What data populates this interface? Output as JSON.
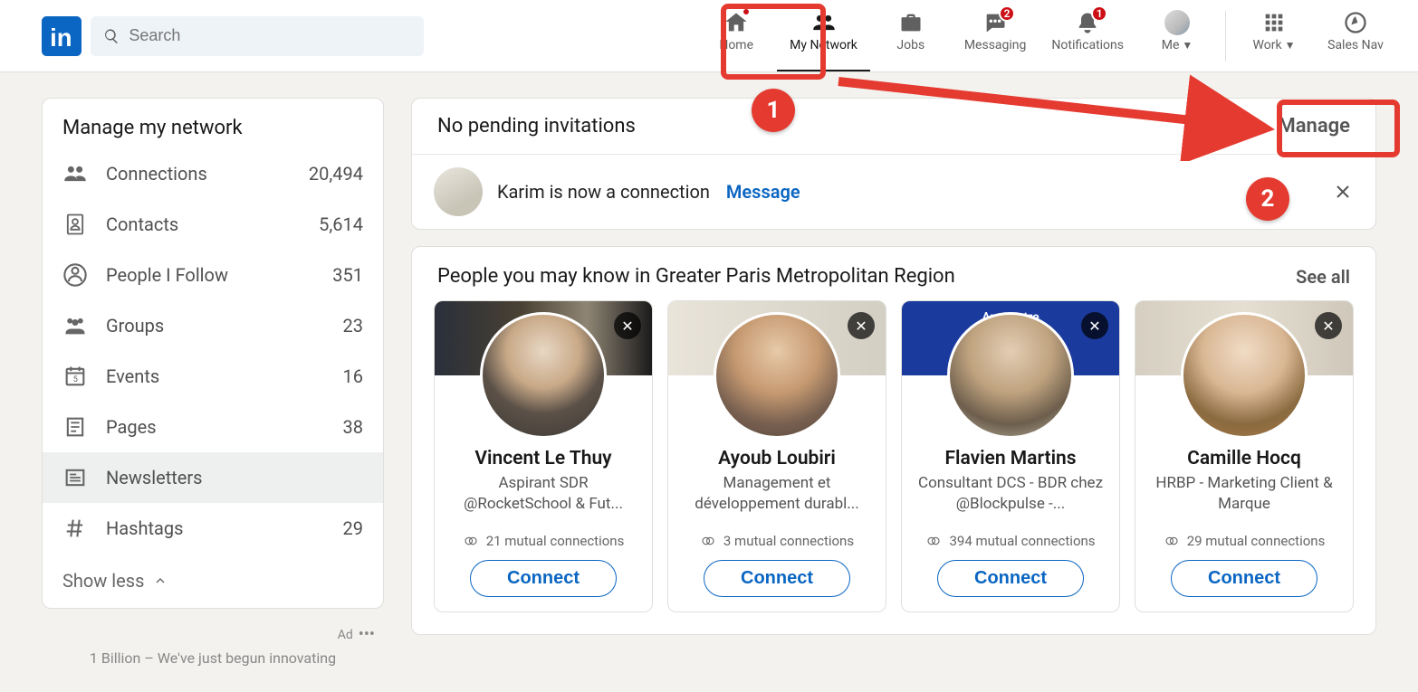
{
  "search": {
    "placeholder": "Search"
  },
  "nav": {
    "home": {
      "label": "Home",
      "badge": ""
    },
    "network": {
      "label": "My Network"
    },
    "jobs": {
      "label": "Jobs"
    },
    "messaging": {
      "label": "Messaging",
      "badge": "2"
    },
    "notifications": {
      "label": "Notifications",
      "badge": "1"
    },
    "me": {
      "label": "Me"
    },
    "work": {
      "label": "Work"
    },
    "salesnav": {
      "label": "Sales Nav"
    }
  },
  "sidebar": {
    "title": "Manage my network",
    "items": [
      {
        "label": "Connections",
        "count": "20,494"
      },
      {
        "label": "Contacts",
        "count": "5,614"
      },
      {
        "label": "People I Follow",
        "count": "351"
      },
      {
        "label": "Groups",
        "count": "23"
      },
      {
        "label": "Events",
        "count": "16"
      },
      {
        "label": "Pages",
        "count": "38"
      },
      {
        "label": "Newsletters",
        "count": ""
      },
      {
        "label": "Hashtags",
        "count": "29"
      }
    ],
    "show_less": "Show less"
  },
  "ad": {
    "label": "Ad",
    "tagline": "1 Billion – We've just begun innovating"
  },
  "invitations": {
    "header": "No pending invitations",
    "manage": "Manage",
    "new_conn_text": "Karim is now a connection",
    "message": "Message"
  },
  "pymk": {
    "header": "People you may know in Greater Paris Metropolitan Region",
    "see_all": "See all",
    "connect_label": "Connect",
    "bg3_text": "Au c   votre",
    "cards": [
      {
        "name": "Vincent Le Thuy",
        "sub": "Aspirant SDR @RocketSchool & Fut...",
        "mutual": "21 mutual connections"
      },
      {
        "name": "Ayoub Loubiri",
        "sub": "Management et développement durabl...",
        "mutual": "3 mutual connections"
      },
      {
        "name": "Flavien Martins",
        "sub": "Consultant DCS - BDR chez @Blockpulse -...",
        "mutual": "394 mutual connections"
      },
      {
        "name": "Camille Hocq",
        "sub": "HRBP - Marketing Client & Marque",
        "mutual": "29 mutual connections"
      }
    ]
  },
  "annotations": {
    "one": "1",
    "two": "2"
  }
}
